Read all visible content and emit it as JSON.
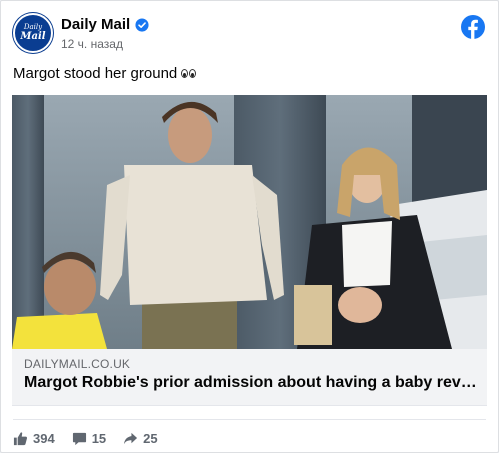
{
  "post": {
    "page_name": "Daily Mail",
    "timestamp": "12 ч. назад",
    "text": "Margot stood her ground",
    "emoji": "eyes-emoji"
  },
  "avatar": {
    "line1": "Daily",
    "line2": "Mail"
  },
  "link": {
    "domain": "DAILYMAIL.CO.UK",
    "title": "Margot Robbie's prior admission about having a baby reve..."
  },
  "stats": {
    "likes": "394",
    "comments": "15",
    "shares": "25"
  },
  "icons": {
    "verified": "verified-badge-icon",
    "facebook": "facebook-logo-icon",
    "like": "thumbs-up-icon",
    "comment": "comment-icon",
    "share": "share-icon"
  },
  "colors": {
    "facebook_blue": "#1877f2",
    "daily_mail_navy": "#0a3d91",
    "secondary_text": "#65676b",
    "link_meta_bg": "#f2f3f5"
  }
}
